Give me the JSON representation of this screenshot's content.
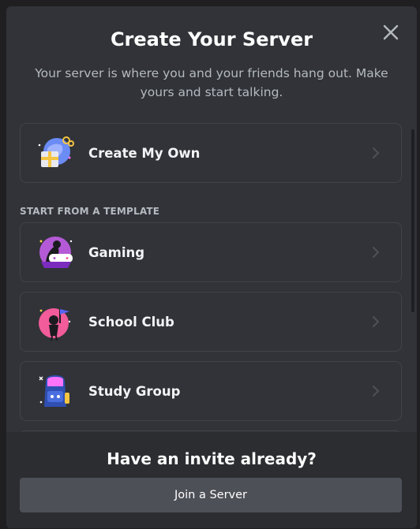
{
  "modal": {
    "title": "Create Your Server",
    "subtitle": "Your server is where you and your friends hang out. Make yours and start talking.",
    "close_icon": "close-icon"
  },
  "create_own": {
    "label": "Create My Own",
    "icon": "globe-gift-icon"
  },
  "templates": {
    "section_label": "START FROM A TEMPLATE",
    "items": [
      {
        "label": "Gaming",
        "icon": "gaming-icon"
      },
      {
        "label": "School Club",
        "icon": "school-club-icon"
      },
      {
        "label": "Study Group",
        "icon": "study-group-icon"
      }
    ]
  },
  "footer": {
    "title": "Have an invite already?",
    "join_label": "Join a Server"
  },
  "colors": {
    "modal_bg": "#313338",
    "footer_bg": "#2b2d31",
    "button_bg": "#4e5058",
    "muted_text": "#b5bac1"
  }
}
